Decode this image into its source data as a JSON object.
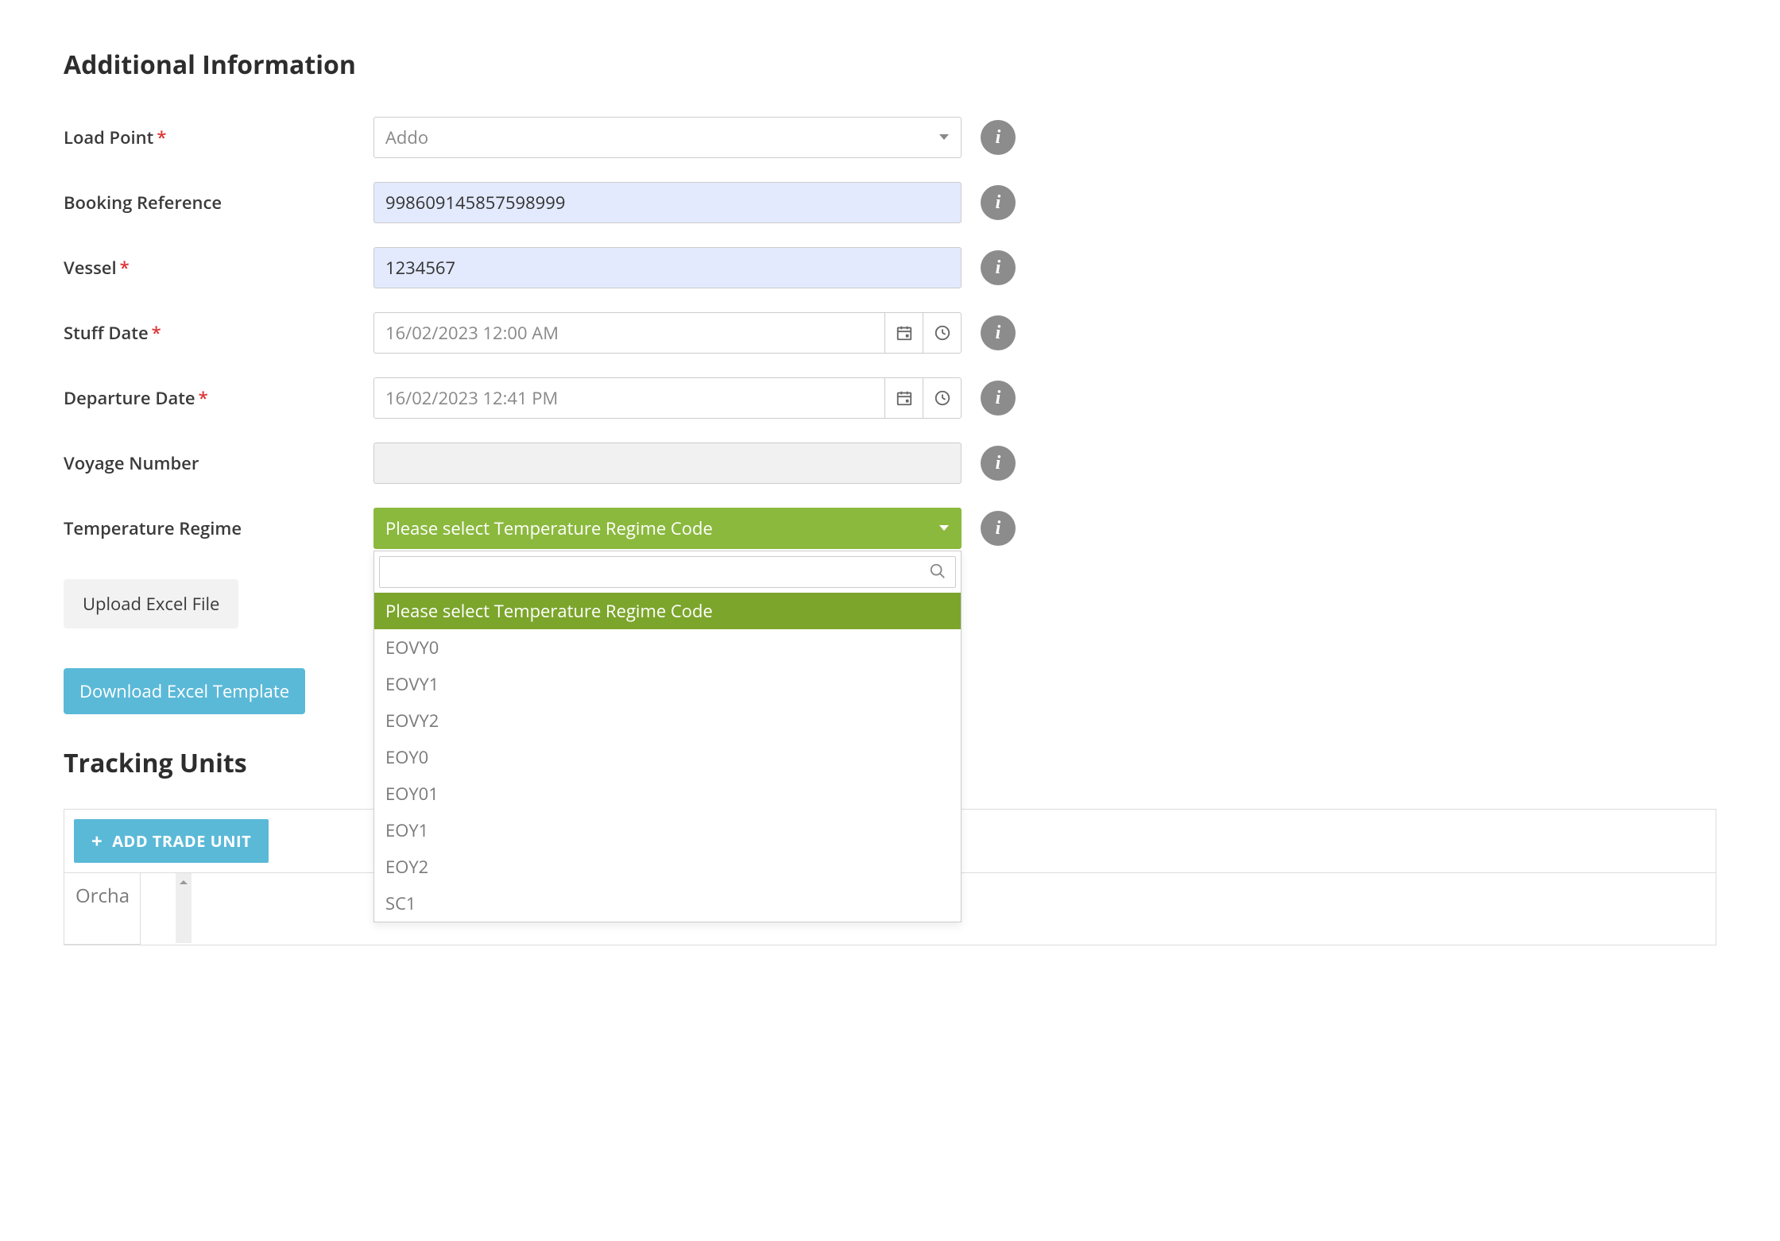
{
  "section_title": "Additional Information",
  "fields": {
    "load_point": {
      "label": "Load Point",
      "required": true,
      "value": "Addo"
    },
    "booking_ref": {
      "label": "Booking Reference",
      "required": false,
      "value": "998609145857598999"
    },
    "vessel": {
      "label": "Vessel",
      "required": true,
      "value": "1234567"
    },
    "stuff_date": {
      "label": "Stuff Date",
      "required": true,
      "value": "16/02/2023 12:00 AM"
    },
    "departure_date": {
      "label": "Departure Date",
      "required": true,
      "value": "16/02/2023 12:41 PM"
    },
    "voyage_number": {
      "label": "Voyage Number",
      "required": false,
      "value": ""
    },
    "temp_regime": {
      "label": "Temperature Regime",
      "required": false,
      "placeholder": "Please select Temperature Regime Code",
      "options": [
        "Please select Temperature Regime Code",
        "EOVY0",
        "EOVY1",
        "EOVY2",
        "EOY0",
        "EOY01",
        "EOY1",
        "EOY2",
        "SC1"
      ],
      "selected_index": 0
    }
  },
  "buttons": {
    "upload": "Upload Excel File",
    "download": "Download Excel Template",
    "add_trade_unit": "ADD TRADE UNIT"
  },
  "tracking_title": "Tracking Units",
  "table": {
    "col0_header": "Orcha"
  }
}
